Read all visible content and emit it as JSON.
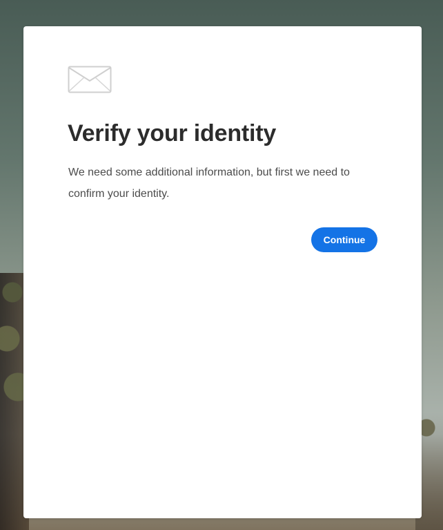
{
  "dialog": {
    "icon": "mail-icon",
    "title": "Verify your identity",
    "body": "We need some additional information, but first we need to confirm your identity.",
    "continue_label": "Continue"
  },
  "colors": {
    "primary_button": "#1473e6",
    "title_text": "#2c2c2c",
    "body_text": "#4b4b4b",
    "dialog_background": "#ffffff"
  }
}
